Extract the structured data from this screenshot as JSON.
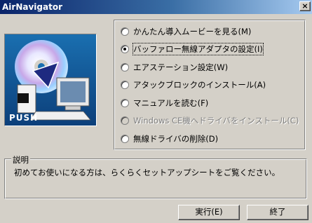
{
  "window": {
    "title": "AirNavigator",
    "close_symbol": "×"
  },
  "logo": {
    "push_label": "PUSH"
  },
  "options": [
    {
      "label": "かんたん導入ムービーを見る(M)",
      "checked": false,
      "disabled": false
    },
    {
      "label": "バッファロー無線アダプタの設定(I)",
      "checked": true,
      "disabled": false
    },
    {
      "label": "エアステーション設定(W)",
      "checked": false,
      "disabled": false
    },
    {
      "label": "アタックブロックのインストール(A)",
      "checked": false,
      "disabled": false
    },
    {
      "label": "マニュアルを読む(F)",
      "checked": false,
      "disabled": false
    },
    {
      "label": "Windows CE機へドライバをインストール(C)",
      "checked": false,
      "disabled": true
    },
    {
      "label": "無線ドライバの削除(D)",
      "checked": false,
      "disabled": false
    }
  ],
  "explanation": {
    "title": "説明",
    "text": "初めてお使いになる方は、らくらくセットアップシートをご覧ください。"
  },
  "buttons": {
    "execute": "実行(E)",
    "exit": "終了"
  }
}
